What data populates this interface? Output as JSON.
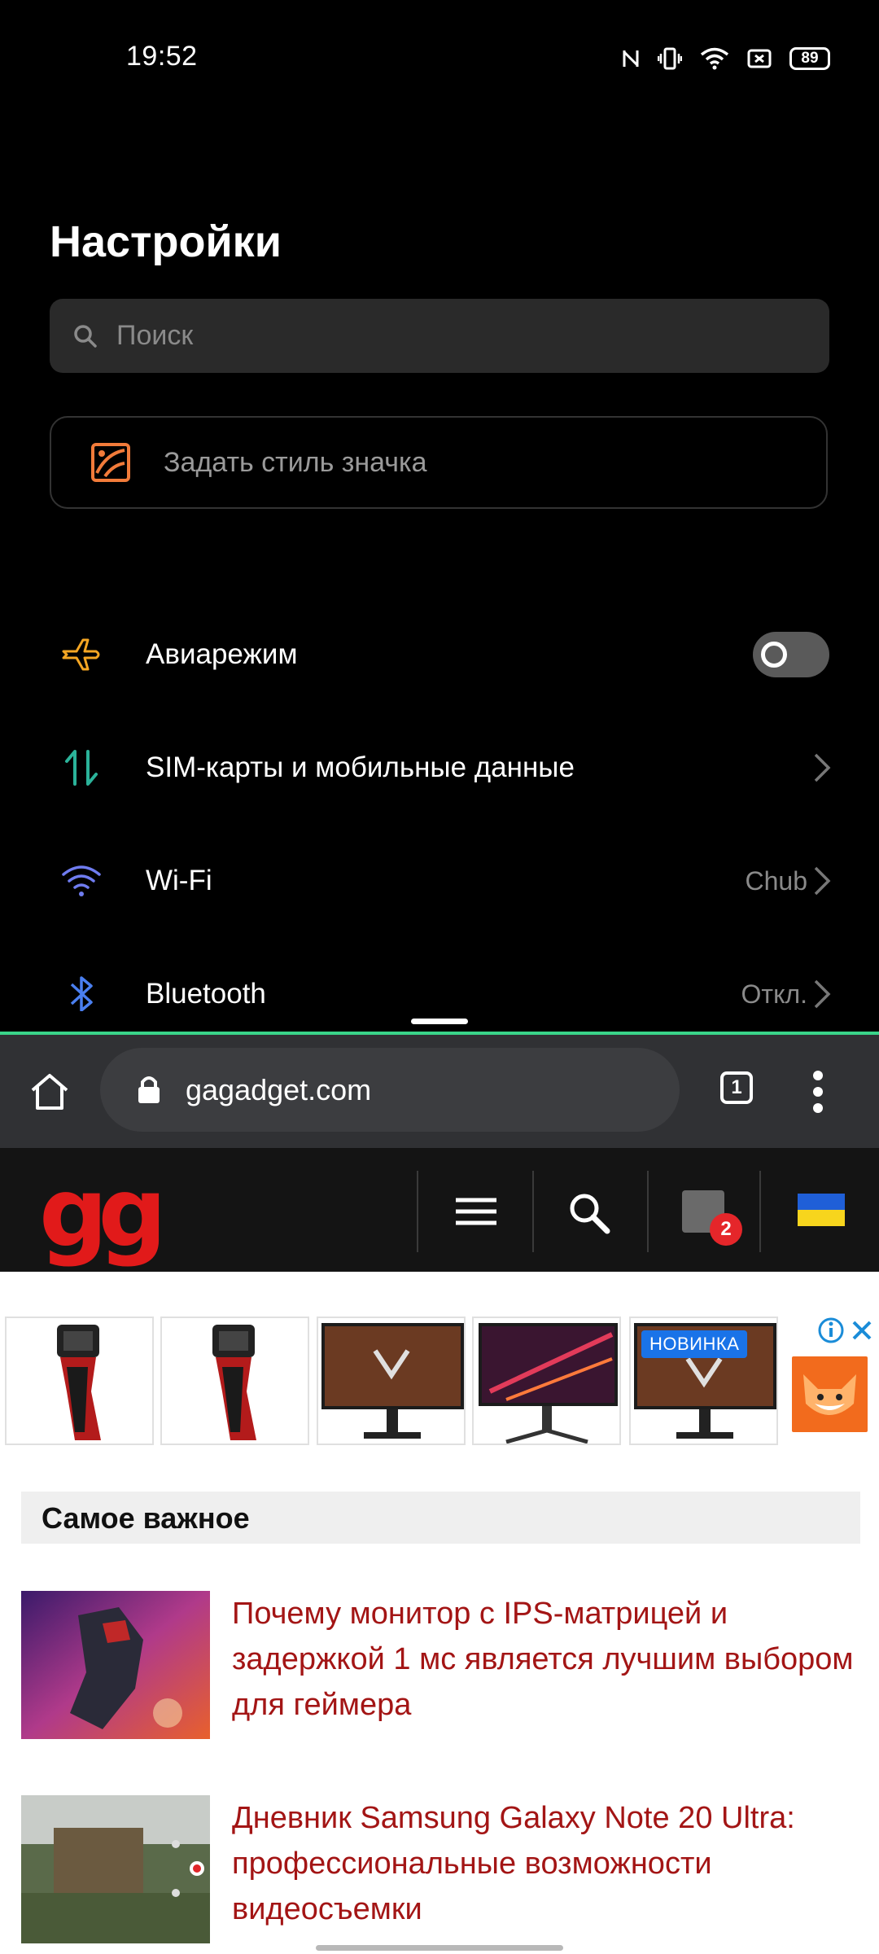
{
  "status_bar": {
    "time": "19:52",
    "battery": "89",
    "icons": [
      "nfc-icon",
      "vibrate-icon",
      "wifi-icon",
      "screen-record-icon",
      "battery-icon"
    ]
  },
  "settings": {
    "title": "Настройки",
    "search_placeholder": "Поиск",
    "icon_style_label": "Задать стиль значка",
    "items": [
      {
        "label": "Авиарежим",
        "icon": "airplane-icon",
        "toggle": "off"
      },
      {
        "label": "SIM-карты и мобильные данные",
        "icon": "sim-data-icon"
      },
      {
        "label": "Wi-Fi",
        "value": "Chub",
        "icon": "wifi-icon"
      },
      {
        "label": "Bluetooth",
        "value": "Откл.",
        "icon": "bluetooth-icon"
      }
    ]
  },
  "browser": {
    "url": "gagadget.com",
    "tab_count": "1"
  },
  "site": {
    "logo": "gg",
    "notification_count": "2",
    "ad_badge": "НОВИНКА",
    "section_title": "Самое важное",
    "articles": [
      {
        "title": "Почему монитор с IPS-матрицей и задержкой 1 мс является лучшим выбором для геймера"
      },
      {
        "title": "Дневник Samsung Galaxy Note 20 Ultra: профессиональные возможности видеосъемки"
      }
    ]
  },
  "colors": {
    "accent_green": "#3ad58a",
    "link_red": "#a31515",
    "logo_red": "#e11a1a"
  }
}
